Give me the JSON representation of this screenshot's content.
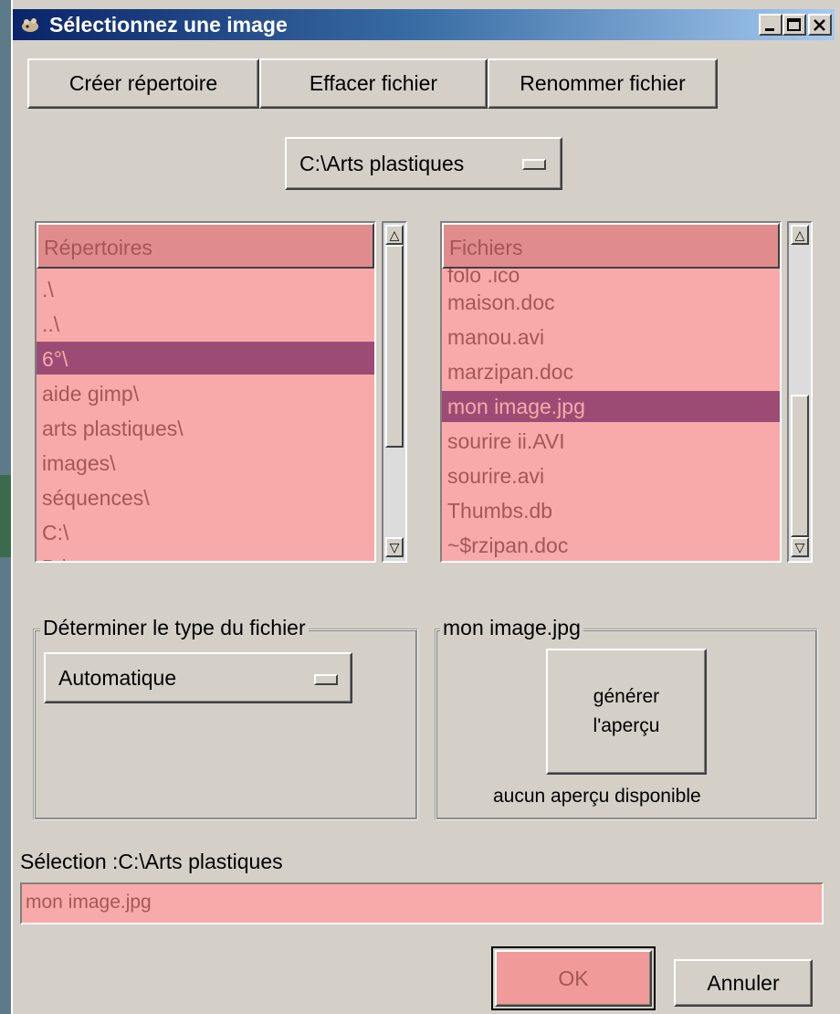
{
  "window": {
    "title": "Sélectionnez une image",
    "controls": {
      "minimize": "_",
      "maximize": "□",
      "close": "×"
    }
  },
  "toolbar": {
    "create_dir": "Créer répertoire",
    "delete_file": "Effacer fichier",
    "rename_file": "Renommer fichier"
  },
  "path_menu": {
    "value": "C:\\Arts plastiques"
  },
  "directories": {
    "header": "Répertoires",
    "items": [
      ".\\",
      "..\\",
      "6°\\",
      "aide gimp\\",
      "arts plastiques\\",
      "images\\",
      "séquences\\",
      "C:\\",
      "D:\\"
    ],
    "selected_index": 2
  },
  "files": {
    "header": "Fichiers",
    "items": [
      "folo .ico",
      "maison.doc",
      "manou.avi",
      "marzipan.doc",
      "mon image.jpg",
      "sourire ii.AVI",
      "sourire.avi",
      "Thumbs.db",
      "~$rzipan.doc"
    ],
    "selected_index": 4
  },
  "file_type": {
    "legend": "Déterminer le type du fichier",
    "value": "Automatique"
  },
  "preview": {
    "legend": "mon image.jpg",
    "button_line1": "générer",
    "button_line2": "l'aperçu",
    "status": "aucun aperçu disponible"
  },
  "selection": {
    "label": "Sélection :C:\\Arts plastiques",
    "value": "mon image.jpg"
  },
  "actions": {
    "ok": "OK",
    "cancel": "Annuler"
  },
  "colors": {
    "list_bg": "#f8aaaa",
    "list_header": "#e08c8c",
    "selected_row": "#9c4c74",
    "title_start": "#0a246a"
  }
}
